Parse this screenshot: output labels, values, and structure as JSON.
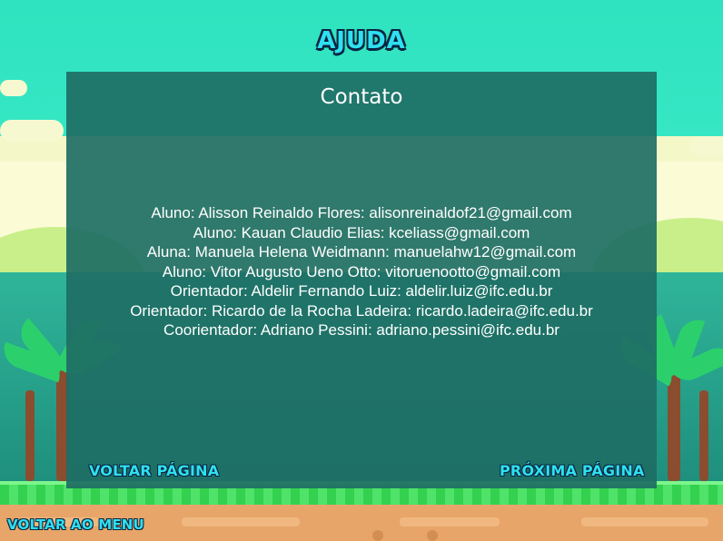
{
  "header": {
    "title": "AJUDA"
  },
  "panel": {
    "title": "Contato",
    "contacts": [
      "Aluno: Alisson Reinaldo Flores: alisonreinaldof21@gmail.com",
      "Aluno: Kauan Claudio Elias: kceliass@gmail.com",
      "Aluna: Manuela Helena Weidmann: manuelahw12@gmail.com",
      "Aluno: Vitor Augusto Ueno Otto: vitoruenootto@gmail.com",
      "Orientador: Aldelir Fernando Luiz: aldelir.luiz@ifc.edu.br",
      "Orientador: Ricardo de la Rocha Ladeira: ricardo.ladeira@ifc.edu.br",
      "Coorientador: Adriano Pessini: adriano.pessini@ifc.edu.br"
    ]
  },
  "navigation": {
    "prev_label": "VOLTAR PÁGINA",
    "next_label": "PRÓXIMA PÁGINA",
    "menu_label": "VOLTAR AO MENU"
  },
  "colors": {
    "accent": "#2fe0f0",
    "panel": "#1e6e64",
    "sky": "#34e6c2",
    "grass": "#33d14f",
    "ground": "#e7a569"
  }
}
